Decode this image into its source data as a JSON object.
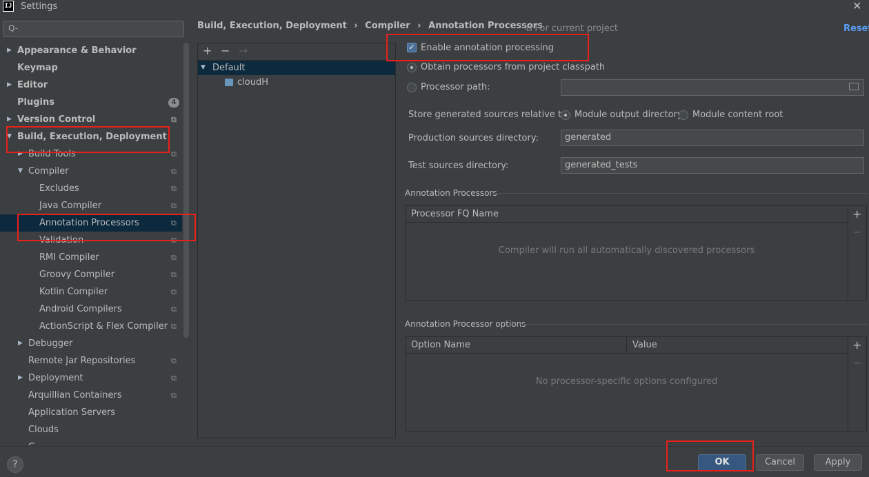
{
  "window": {
    "title": "Settings",
    "app_icon_text": "IJ"
  },
  "sidebar": {
    "search_placeholder": "Q-",
    "items": [
      {
        "label": "Appearance & Behavior"
      },
      {
        "label": "Keymap"
      },
      {
        "label": "Editor"
      },
      {
        "label": "Plugins",
        "badge": "4"
      },
      {
        "label": "Version Control"
      },
      {
        "label": "Build, Execution, Deployment"
      },
      {
        "label": "Build Tools"
      },
      {
        "label": "Compiler"
      },
      {
        "label": "Excludes"
      },
      {
        "label": "Java Compiler"
      },
      {
        "label": "Annotation Processors"
      },
      {
        "label": "Validation"
      },
      {
        "label": "RMI Compiler"
      },
      {
        "label": "Groovy Compiler"
      },
      {
        "label": "Kotlin Compiler"
      },
      {
        "label": "Android Compilers"
      },
      {
        "label": "ActionScript & Flex Compiler"
      },
      {
        "label": "Debugger"
      },
      {
        "label": "Remote Jar Repositories"
      },
      {
        "label": "Deployment"
      },
      {
        "label": "Arquillian Containers"
      },
      {
        "label": "Application Servers"
      },
      {
        "label": "Clouds"
      },
      {
        "label": "C..."
      }
    ]
  },
  "header": {
    "breadcrumb": [
      "Build, Execution, Deployment",
      "›",
      "Compiler",
      "›",
      "Annotation Processors"
    ],
    "scope_label": "For current project",
    "reset_label": "Reset"
  },
  "profiles": {
    "toolbar": {
      "add": "+",
      "remove": "−",
      "move": "→"
    },
    "items": [
      {
        "label": "Default"
      },
      {
        "label": "cloudH"
      }
    ]
  },
  "settings": {
    "enable_label": "Enable annotation processing",
    "obtain_label": "Obtain processors from project classpath",
    "path_label": "Processor path:",
    "path_value": "",
    "store_label": "Store generated sources relative to:",
    "module_output_label": "Module output directory",
    "module_content_label": "Module content root",
    "production_label": "Production sources directory:",
    "production_value": "generated",
    "test_label": "Test sources directory:",
    "test_value": "generated_tests",
    "processors_section": "Annotation Processors",
    "processors_header": "Processor FQ Name",
    "processors_empty": "Compiler will run all automatically discovered processors",
    "options_section": "Annotation Processor options",
    "options_header_name": "Option Name",
    "options_header_value": "Value",
    "options_empty": "No processor-specific options configured",
    "add_symbol": "+",
    "remove_symbol": "−"
  },
  "footer": {
    "help_label": "?",
    "ok_label": "OK",
    "cancel_label": "Cancel",
    "apply_label": "Apply"
  },
  "colors": {
    "background": "#3c3f41",
    "selection": "#0d293e",
    "link": "#589df6",
    "annotation_red": "#e8201c",
    "primary_button": "#365880"
  },
  "states": {
    "enable_annotation_processing": true,
    "processor_source": "Obtain processors from project classpath",
    "store_relative_to": "Module output directory",
    "selected_sidebar_item": "Annotation Processors",
    "selected_profile": "Default"
  }
}
